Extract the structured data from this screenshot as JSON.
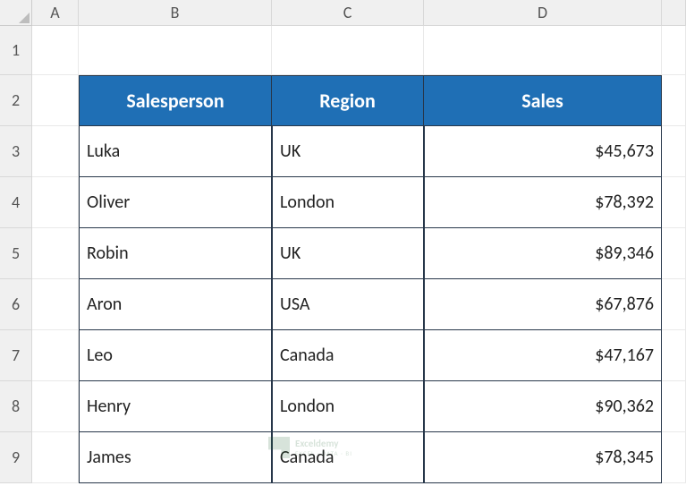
{
  "columns": [
    "A",
    "B",
    "C",
    "D",
    ""
  ],
  "rows": [
    "1",
    "2",
    "3",
    "4",
    "5",
    "6",
    "7",
    "8",
    "9"
  ],
  "table": {
    "headers": {
      "salesperson": "Salesperson",
      "region": "Region",
      "sales": "Sales"
    },
    "data": [
      {
        "salesperson": "Luka",
        "region": "UK",
        "sales": "$45,673"
      },
      {
        "salesperson": "Oliver",
        "region": "London",
        "sales": "$78,392"
      },
      {
        "salesperson": "Robin",
        "region": "UK",
        "sales": "$89,346"
      },
      {
        "salesperson": "Aron",
        "region": "USA",
        "sales": "$67,876"
      },
      {
        "salesperson": "Leo",
        "region": "Canada",
        "sales": "$47,167"
      },
      {
        "salesperson": "Henry",
        "region": "London",
        "sales": "$90,362"
      },
      {
        "salesperson": "James",
        "region": "Canada",
        "sales": "$78,345"
      }
    ]
  },
  "watermark": {
    "line1": "Exceldemy",
    "line2": "EXCEL · DATA · BI"
  }
}
